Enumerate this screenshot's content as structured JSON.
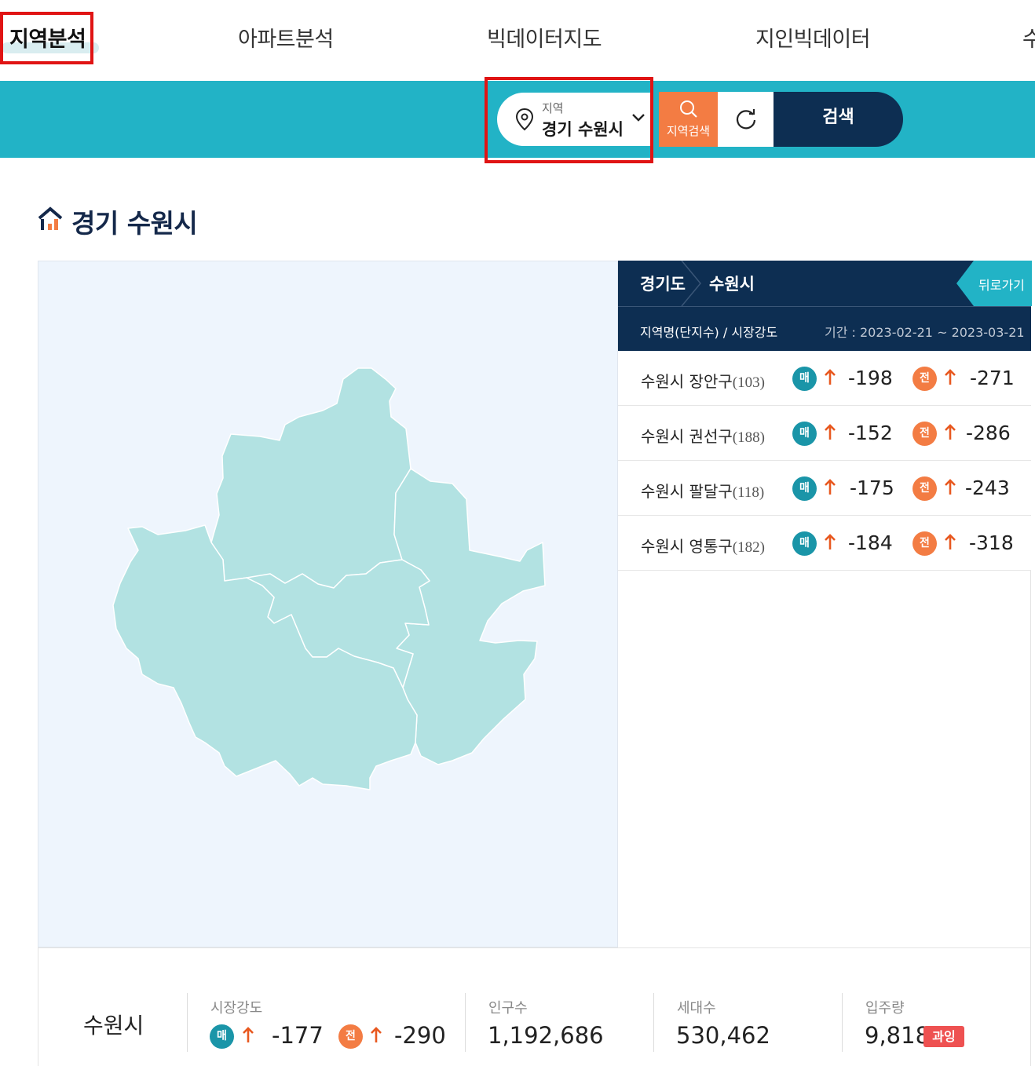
{
  "nav": {
    "items": [
      "지역분석",
      "아파트분석",
      "빅데이터지도",
      "지인빅데이터",
      "수"
    ]
  },
  "search": {
    "region_label": "지역",
    "region_value": "경기 수원시",
    "region_search_label": "지역검색",
    "search_button": "검색"
  },
  "page": {
    "title": "경기 수원시"
  },
  "panel": {
    "breadcrumb": [
      "경기도",
      "수원시"
    ],
    "back_label": "뒤로가기",
    "header_left": "지역명(단지수) / 시장강도",
    "header_right": "기간 : 2023-02-21 ~ 2023-03-21",
    "sale_badge": "매",
    "jeonse_badge": "전",
    "rows": [
      {
        "name": "수원시 장안구",
        "count": "(103)",
        "sale": "-198",
        "jeonse": "-271"
      },
      {
        "name": "수원시 권선구",
        "count": "(188)",
        "sale": "-152",
        "jeonse": "-286"
      },
      {
        "name": "수원시 팔달구",
        "count": "(118)",
        "sale": "-175",
        "jeonse": "-243"
      },
      {
        "name": "수원시 영통구",
        "count": "(182)",
        "sale": "-184",
        "jeonse": "-318"
      }
    ]
  },
  "summary": {
    "city": "수원시",
    "market_label": "시장강도",
    "market_sale": "-177",
    "market_jeonse": "-290",
    "population_label": "인구수",
    "population": "1,192,686",
    "households_label": "세대수",
    "households": "530,462",
    "supply_label": "입주량",
    "supply": "9,818",
    "supply_tag": "과잉"
  },
  "colors": {
    "accent": "#22b3c6",
    "navy": "#0d2e52",
    "orange": "#f37c43",
    "teal_badge": "#1a95a8",
    "map_fill": "#b2e2e2",
    "highlight": "#e01414"
  }
}
